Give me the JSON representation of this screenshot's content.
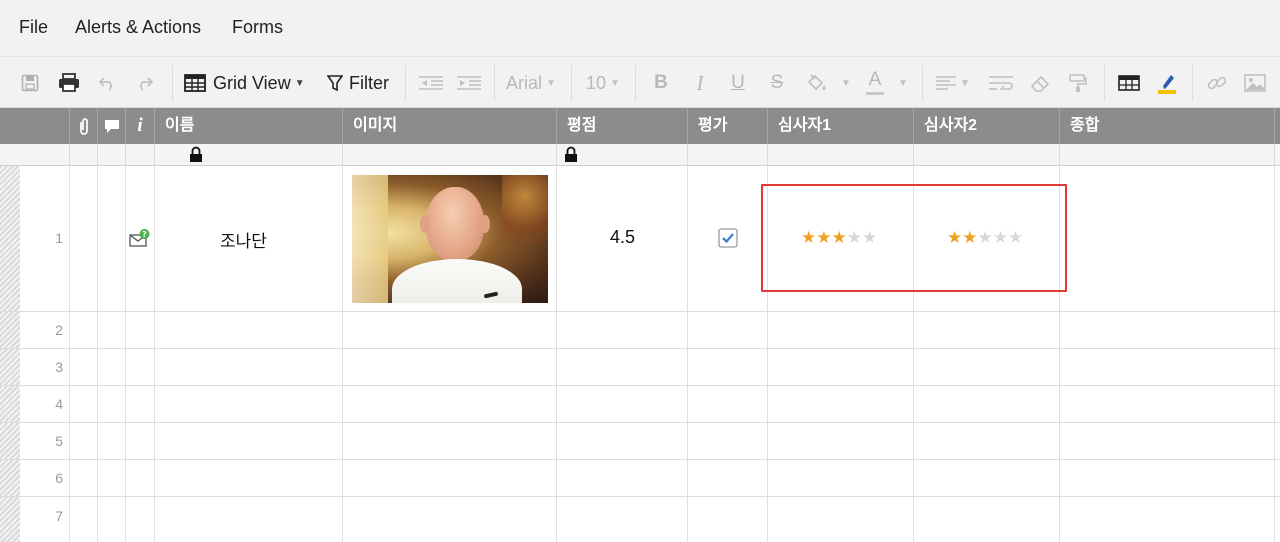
{
  "menu": {
    "file": "File",
    "alerts": "Alerts & Actions",
    "forms": "Forms"
  },
  "toolbar": {
    "view_label": "Grid View",
    "filter_label": "Filter",
    "font_name": "Arial",
    "font_size": "10",
    "bold": "B",
    "italic": "I",
    "underline": "U",
    "strike": "S",
    "text_color": "A"
  },
  "header": {
    "info": "i",
    "name": "이름",
    "image": "이미지",
    "score": "평점",
    "eval": "평가",
    "judge1": "심사자1",
    "judge2": "심사자2",
    "total": "종합"
  },
  "rows": [
    {
      "num": "1",
      "name": "조나단",
      "score": "4.5",
      "checked": true,
      "judge1_stars": 3,
      "judge2_stars": 2,
      "has_image": true,
      "has_comment_alert": true
    },
    {
      "num": "2"
    },
    {
      "num": "3"
    },
    {
      "num": "4"
    },
    {
      "num": "5"
    },
    {
      "num": "6"
    },
    {
      "num": "7"
    }
  ],
  "colors": {
    "header_bg": "#8c8c8c",
    "star_on": "#f0a020",
    "star_off": "#d8d8d8",
    "highlight_box": "#e53935",
    "check_blue": "#3a7bd5"
  },
  "icons": [
    "save-icon",
    "print-icon",
    "undo-icon",
    "redo-icon",
    "grid-view-icon",
    "filter-icon",
    "outdent-icon",
    "indent-icon",
    "paint-bucket-icon",
    "align-icon",
    "wrap-text-icon",
    "eraser-icon",
    "format-painter-icon",
    "table-icon",
    "highlighter-icon",
    "link-icon",
    "image-icon",
    "paperclip-icon",
    "comment-icon",
    "lock-icon",
    "mail-alert-icon",
    "checkbox-icon",
    "star-icon"
  ]
}
